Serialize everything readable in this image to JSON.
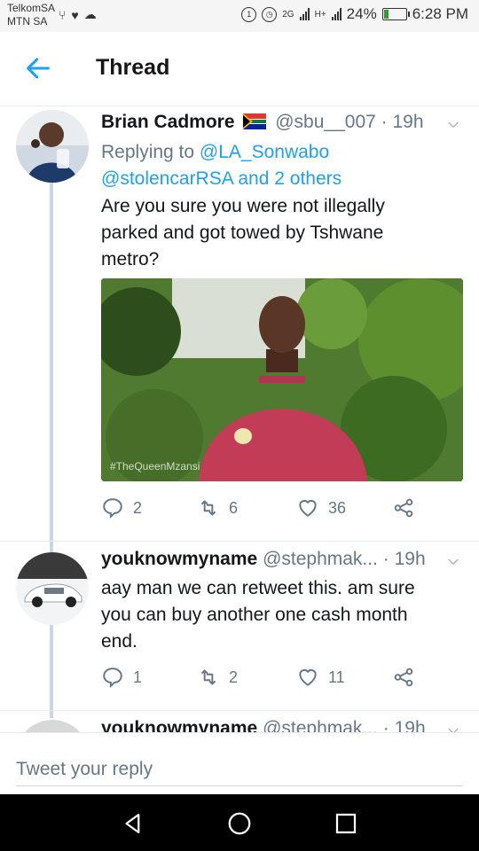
{
  "status_bar": {
    "carrier_1": "TelkomSA",
    "carrier_2": "MTN SA",
    "network_1": "2G",
    "network_2": "H+",
    "battery": "24%",
    "battery_level": 0.24,
    "time": "6:28 PM"
  },
  "header": {
    "title": "Thread",
    "back_icon": "arrow-left-icon"
  },
  "tweets": [
    {
      "name": "Brian Cadmore",
      "flag": "south-africa-flag-icon",
      "handle": "@sbu__007",
      "time": "· 19h",
      "replying_prefix": "Replying to ",
      "replying_users_line1": "@LA_Sonwabo",
      "replying_users_line2": "@stolencarRSA and 2 others",
      "text_line1": "Are you sure you were not illegally",
      "text_line2": "parked and got towed by Tshwane",
      "text_line3": "metro?",
      "media_watermark": "#TheQueenMzansi",
      "replies": "2",
      "retweets": "6",
      "likes": "36"
    },
    {
      "name": "youknowmyname",
      "handle": "@stephmak...",
      "time": "· 19h",
      "text_line1": "aay man we can retweet this. am sure",
      "text_line2": "you can buy another one cash month",
      "text_line3": "end.",
      "replies": "1",
      "retweets": "2",
      "likes": "11"
    },
    {
      "name": "youknowmyname",
      "handle": "@stephmak...",
      "time": "· 19h"
    }
  ],
  "reply_box": {
    "placeholder": "Tweet your reply"
  },
  "colors": {
    "accent": "#1da1f2",
    "text_primary": "#14171a",
    "text_secondary": "#657786",
    "thread_line": "#ccd6dd"
  }
}
